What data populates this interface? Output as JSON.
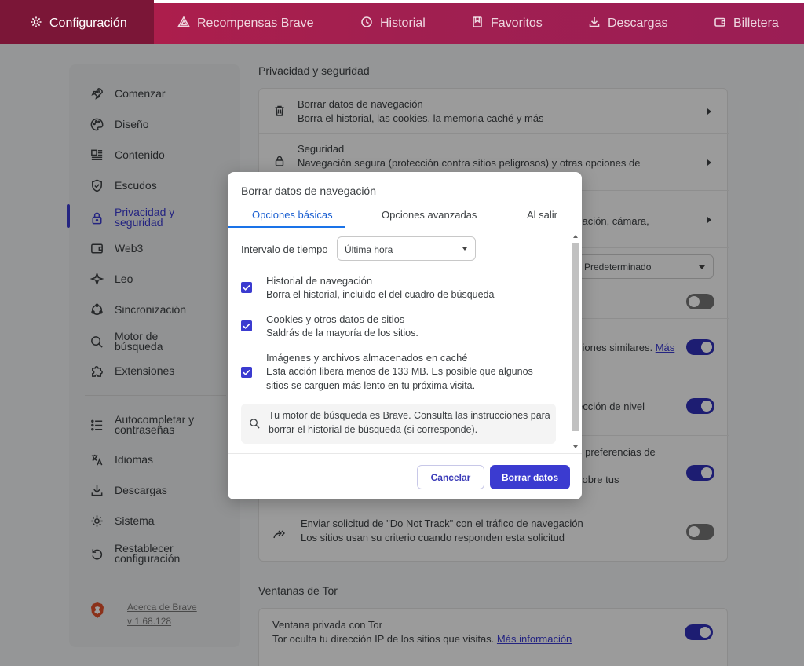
{
  "topnav": {
    "tabs": [
      {
        "label": "Configuración",
        "icon": "gear-icon"
      },
      {
        "label": "Recompensas Brave",
        "icon": "triangle-icon"
      },
      {
        "label": "Historial",
        "icon": "history-icon"
      },
      {
        "label": "Favoritos",
        "icon": "bookmark-icon"
      },
      {
        "label": "Descargas",
        "icon": "download-icon"
      },
      {
        "label": "Billetera",
        "icon": "wallet-icon"
      }
    ]
  },
  "sidebar": {
    "items": [
      {
        "label": "Comenzar"
      },
      {
        "label": "Diseño"
      },
      {
        "label": "Contenido"
      },
      {
        "label": "Escudos"
      },
      {
        "label": "Privacidad y seguridad"
      },
      {
        "label": "Web3"
      },
      {
        "label": "Leo"
      },
      {
        "label": "Sincronización"
      },
      {
        "label": "Motor de búsqueda"
      },
      {
        "label": "Extensiones"
      },
      {
        "label": "Autocompletar y contraseñas"
      },
      {
        "label": "Idiomas"
      },
      {
        "label": "Descargas"
      },
      {
        "label": "Sistema"
      },
      {
        "label": "Restablecer configuración"
      }
    ],
    "about": {
      "line1": "Acerca de Brave",
      "line2": "v 1.68.128"
    }
  },
  "main": {
    "privacy_title": "Privacidad y seguridad",
    "rows": {
      "clear_title": "Borrar datos de navegación",
      "clear_desc": "Borra el historial, las cookies, la memoria caché y más",
      "security_title": "Seguridad",
      "security_desc": "Navegación segura (protección contra sitios peligrosos) y otras opciones de",
      "site_desc": "cación, cámara,",
      "select_value": "Predeterminado",
      "similar_text": "siones similares.",
      "similar_link": "Más",
      "level_text": "ección de nivel",
      "prefs_text": "s preferencias de",
      "about_text": "sobre tus",
      "dnt_title": "Enviar solicitud de \"Do Not Track\" con el tráfico de navegación",
      "dnt_desc": "Los sitios usan su criterio cuando responden esta solicitud"
    },
    "tor_title": "Ventanas de Tor",
    "tor": {
      "title": "Ventana privada con Tor",
      "desc": "Tor oculta tu dirección IP de los sitios que visitas.",
      "link": "Más información"
    }
  },
  "dialog": {
    "title": "Borrar datos de navegación",
    "tabs": [
      "Opciones básicas",
      "Opciones avanzadas",
      "Al salir"
    ],
    "interval_label": "Intervalo de tiempo",
    "interval_value": "Última hora",
    "options": [
      {
        "title": "Historial de navegación",
        "desc": "Borra el historial, incluido el del cuadro de búsqueda",
        "checked": true
      },
      {
        "title": "Cookies y otros datos de sitios",
        "desc": "Saldrás de la mayoría de los sitios.",
        "checked": true
      },
      {
        "title": "Imágenes y archivos almacenados en caché",
        "desc": "Esta acción libera menos de 133 MB. Es posible que algunos sitios se carguen más lento en tu próxima visita.",
        "checked": true
      }
    ],
    "info": "Tu motor de búsqueda es Brave. Consulta las instrucciones para borrar el historial de búsqueda (si corresponde).",
    "cancel": "Cancelar",
    "confirm": "Borrar datos"
  },
  "colors": {
    "accent": "#3b3bd0",
    "nav": "#a11f50",
    "nav_active": "#7b1637"
  }
}
